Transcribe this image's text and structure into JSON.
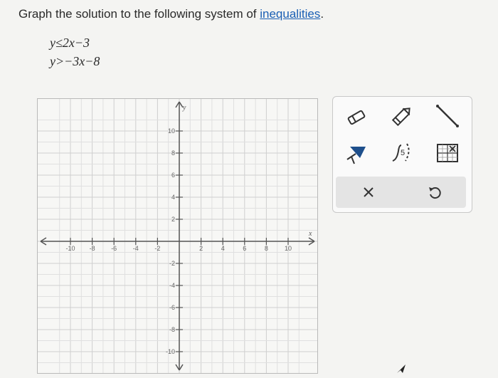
{
  "prompt": {
    "text_before": "Graph the solution to the following system of ",
    "link_text": "inequalities",
    "text_after": "."
  },
  "system": {
    "inequality_1": "y≤2x−3",
    "inequality_2": "y>−3x−8"
  },
  "graph": {
    "x_axis_label": "x",
    "y_axis_label": "y",
    "x_ticks": [
      "-10",
      "-8",
      "-6",
      "-4",
      "-2",
      "2",
      "4",
      "6",
      "8",
      "10"
    ],
    "y_ticks": [
      "10",
      "8",
      "6",
      "4",
      "2",
      "-2",
      "-4",
      "-6",
      "-8",
      "-10"
    ],
    "range": {
      "xmin": -11,
      "xmax": 11,
      "ymin": -11,
      "ymax": 11
    }
  },
  "tools": [
    {
      "name": "eraser-tool",
      "icon": "eraser-icon"
    },
    {
      "name": "solid-line-tool",
      "icon": "pencil-icon"
    },
    {
      "name": "line-segment-tool",
      "icon": "diagonal-line-icon"
    },
    {
      "name": "shade-region-tool",
      "icon": "paint-bucket-icon"
    },
    {
      "name": "dashed-line-tool",
      "icon": "dashed-curve-icon"
    },
    {
      "name": "grid-options-tool",
      "icon": "grid-x-icon"
    },
    {
      "name": "clear-button",
      "icon": "close-icon"
    },
    {
      "name": "undo-button",
      "icon": "undo-icon"
    }
  ]
}
